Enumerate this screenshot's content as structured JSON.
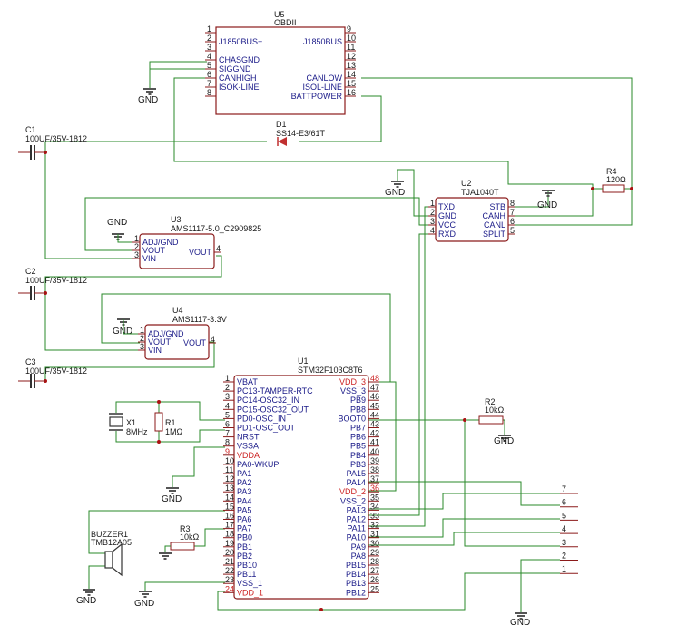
{
  "gnd_label": "GND",
  "components": {
    "u5": {
      "ref": "U5",
      "value": "OBDII",
      "left_pins": [
        {
          "num": "1",
          "name": ""
        },
        {
          "num": "2",
          "name": "J1850BUS+"
        },
        {
          "num": "3",
          "name": ""
        },
        {
          "num": "4",
          "name": "CHASGND"
        },
        {
          "num": "5",
          "name": "SIGGND"
        },
        {
          "num": "6",
          "name": "CANHIGH"
        },
        {
          "num": "7",
          "name": "ISOK-LINE"
        },
        {
          "num": "8",
          "name": ""
        }
      ],
      "right_pins": [
        {
          "num": "9",
          "name": ""
        },
        {
          "num": "10",
          "name": "J1850BUS"
        },
        {
          "num": "11",
          "name": ""
        },
        {
          "num": "12",
          "name": ""
        },
        {
          "num": "13",
          "name": ""
        },
        {
          "num": "14",
          "name": "CANLOW"
        },
        {
          "num": "15",
          "name": "ISOL-LINE"
        },
        {
          "num": "16",
          "name": "BATTPOWER"
        }
      ]
    },
    "d1": {
      "ref": "D1",
      "value": "SS14-E3/61T"
    },
    "c1": {
      "ref": "C1",
      "value": "100UF/35V-1812"
    },
    "c2": {
      "ref": "C2",
      "value": "100UF/35V-1812"
    },
    "c3": {
      "ref": "C3",
      "value": "100UF/35V-1812"
    },
    "r4": {
      "ref": "R4",
      "value": "120Ω"
    },
    "u2": {
      "ref": "U2",
      "value": "TJA1040T",
      "left_pins": [
        {
          "num": "1",
          "name": "TXD"
        },
        {
          "num": "2",
          "name": "GND"
        },
        {
          "num": "3",
          "name": "VCC"
        },
        {
          "num": "4",
          "name": "RXD"
        }
      ],
      "right_pins": [
        {
          "num": "8",
          "name": "STB"
        },
        {
          "num": "7",
          "name": "CANH"
        },
        {
          "num": "6",
          "name": "CANL"
        },
        {
          "num": "5",
          "name": "SPLIT"
        }
      ]
    },
    "u3": {
      "ref": "U3",
      "value": "AMS1117-5.0_C2909825",
      "left_pins": [
        {
          "num": "1",
          "name": "ADJ/GND"
        },
        {
          "num": "2",
          "name": "VOUT"
        },
        {
          "num": "3",
          "name": "VIN"
        }
      ],
      "right_pins": [
        {
          "num": "4",
          "name": "VOUT"
        }
      ]
    },
    "u4": {
      "ref": "U4",
      "value": "AMS1117-3.3V",
      "left_pins": [
        {
          "num": "1",
          "name": "ADJ/GND"
        },
        {
          "num": "2",
          "name": "VOUT"
        },
        {
          "num": "3",
          "name": "VIN"
        }
      ],
      "right_pins": [
        {
          "num": "4",
          "name": "VOUT"
        }
      ]
    },
    "u1": {
      "ref": "U1",
      "value": "STM32F103C8T6",
      "left_pins": [
        {
          "num": "1",
          "name": "VBAT"
        },
        {
          "num": "2",
          "name": "PC13-TAMPER-RTC"
        },
        {
          "num": "3",
          "name": "PC14-OSC32_IN"
        },
        {
          "num": "4",
          "name": "PC15-OSC32_OUT"
        },
        {
          "num": "5",
          "name": "PD0-OSC_IN"
        },
        {
          "num": "6",
          "name": "PD1-OSC_OUT"
        },
        {
          "num": "7",
          "name": "NRST"
        },
        {
          "num": "8",
          "name": "VSSA"
        },
        {
          "num": "9",
          "name": "VDDA",
          "red": true
        },
        {
          "num": "10",
          "name": "PA0-WKUP"
        },
        {
          "num": "11",
          "name": "PA1"
        },
        {
          "num": "12",
          "name": "PA2"
        },
        {
          "num": "13",
          "name": "PA3"
        },
        {
          "num": "14",
          "name": "PA4"
        },
        {
          "num": "15",
          "name": "PA5"
        },
        {
          "num": "16",
          "name": "PA6"
        },
        {
          "num": "17",
          "name": "PA7"
        },
        {
          "num": "18",
          "name": "PB0"
        },
        {
          "num": "19",
          "name": "PB1"
        },
        {
          "num": "20",
          "name": "PB2"
        },
        {
          "num": "21",
          "name": "PB10"
        },
        {
          "num": "22",
          "name": "PB11"
        },
        {
          "num": "23",
          "name": "VSS_1"
        },
        {
          "num": "24",
          "name": "VDD_1",
          "red": true
        }
      ],
      "right_pins": [
        {
          "num": "48",
          "name": "VDD_3",
          "red": true
        },
        {
          "num": "47",
          "name": "VSS_3"
        },
        {
          "num": "46",
          "name": "PB9"
        },
        {
          "num": "45",
          "name": "PB8"
        },
        {
          "num": "44",
          "name": "BOOT0"
        },
        {
          "num": "43",
          "name": "PB7"
        },
        {
          "num": "42",
          "name": "PB6"
        },
        {
          "num": "41",
          "name": "PB5"
        },
        {
          "num": "40",
          "name": "PB4"
        },
        {
          "num": "39",
          "name": "PB3"
        },
        {
          "num": "38",
          "name": "PA15"
        },
        {
          "num": "37",
          "name": "PA14"
        },
        {
          "num": "36",
          "name": "VDD_2",
          "red": true
        },
        {
          "num": "35",
          "name": "VSS_2"
        },
        {
          "num": "34",
          "name": "PA13"
        },
        {
          "num": "33",
          "name": "PA12"
        },
        {
          "num": "32",
          "name": "PA11"
        },
        {
          "num": "31",
          "name": "PA10"
        },
        {
          "num": "30",
          "name": "PA9"
        },
        {
          "num": "29",
          "name": "PA8"
        },
        {
          "num": "28",
          "name": "PB15"
        },
        {
          "num": "27",
          "name": "PB14"
        },
        {
          "num": "26",
          "name": "PB13"
        },
        {
          "num": "25",
          "name": "PB12"
        }
      ]
    },
    "x1": {
      "ref": "X1",
      "value": "8MHz"
    },
    "r1": {
      "ref": "R1",
      "value": "1MΩ"
    },
    "r2": {
      "ref": "R2",
      "value": "10kΩ"
    },
    "r3": {
      "ref": "R3",
      "value": "10kΩ"
    },
    "buzzer1": {
      "ref": "BUZZER1",
      "value": "TMB12A05"
    },
    "header": {
      "pins": [
        "7",
        "6",
        "5",
        "4",
        "3",
        "2",
        "1"
      ]
    }
  }
}
